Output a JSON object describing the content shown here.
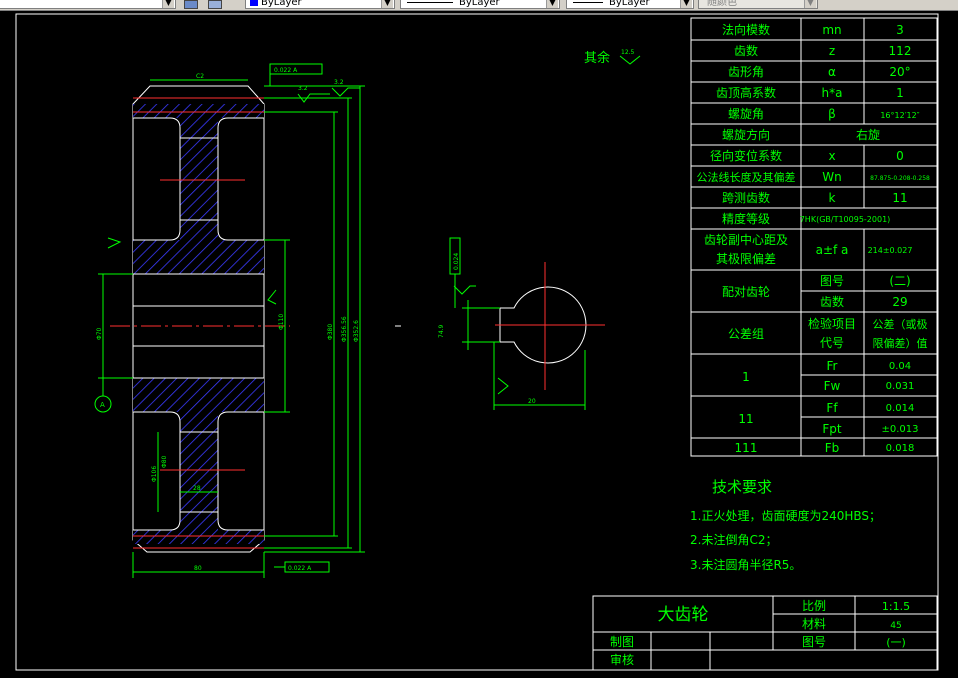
{
  "toolbar": {
    "color_combo": "ByLayer",
    "linetype_combo": "ByLayer",
    "lineweight_combo": "ByLayer",
    "plotstyle_combo": "随颜色"
  },
  "drawing": {
    "roughness_note_label": "其余",
    "roughness_note_value": "12.5",
    "spec_table": [
      {
        "name": "法向模数",
        "symbol": "mn",
        "value": "3"
      },
      {
        "name": "齿数",
        "symbol": "z",
        "value": "112"
      },
      {
        "name": "齿形角",
        "symbol": "α",
        "value": "20°"
      },
      {
        "name": "齿顶高系数",
        "symbol": "h*a",
        "value": "1"
      },
      {
        "name": "螺旋角",
        "symbol": "β",
        "value": "16°12′12″"
      },
      {
        "name": "螺旋方向",
        "symbol": "",
        "value": "右旋"
      },
      {
        "name": "径向变位系数",
        "symbol": "x",
        "value": "0"
      },
      {
        "name": "公法线长度及其偏差",
        "symbol": "Wn",
        "value": "87.875-0.208-0.258"
      },
      {
        "name": "跨测齿数",
        "symbol": "k",
        "value": "11"
      },
      {
        "name": "精度等级",
        "symbol": "",
        "value": "7HK(GB/T10095-2001)"
      }
    ],
    "center_distance_label_line1": "齿轮副中心距及",
    "center_distance_label_line2": "其极限偏差",
    "center_distance_symbol": "a±f a",
    "center_distance_value": "214±0.027",
    "mating_gear_label": "配对齿轮",
    "mating_drawing_no_label": "图号",
    "mating_drawing_no_value": "(二)",
    "mating_teeth_label": "齿数",
    "mating_teeth_value": "29",
    "tolerance_header_group": "公差组",
    "tolerance_header_item_line1": "检验项目",
    "tolerance_header_item_line2": "代号",
    "tolerance_header_value_line1": "公差（或极",
    "tolerance_header_value_line2": "限偏差）值",
    "tolerance_rows": [
      {
        "group": "1",
        "code": "Fr",
        "value": "0.04"
      },
      {
        "group": "",
        "code": "Fw",
        "value": "0.031"
      },
      {
        "group": "11",
        "code": "Ff",
        "value": "0.014"
      },
      {
        "group": "",
        "code": "Fpt",
        "value": "±0.013"
      },
      {
        "group": "111",
        "code": "Fb",
        "value": "0.018"
      }
    ],
    "tech_title": "技术要求",
    "tech_items": [
      "1.正火处理，齿面硬度为240HBS；",
      "2.未注倒角C2；",
      "3.未注圆角半径R5。"
    ],
    "title_block": {
      "part_name": "大齿轮",
      "scale_label": "比例",
      "scale_value": "1:1.5",
      "material_label": "材料",
      "material_value": "45",
      "drawing_no_label": "图号",
      "drawing_no_value": "(一)",
      "drawn_label": "制图",
      "checked_label": "审核"
    },
    "dim_labels": {
      "chamfer": "C2",
      "roughness_a": "3.2",
      "roughness_b": "3.2",
      "runout_top": "0.022 A",
      "runout_bottom": "0.022 A",
      "datum": "A",
      "width": "80",
      "hub_width": "28",
      "bore": "Φ70",
      "key_depth": "74.9",
      "keyway_width": "20",
      "sym_tol": "0.024",
      "d1": "Φ110",
      "d2": "Φ380",
      "d3": "Φ356.56",
      "d4": "Φ352.6",
      "d5": "Φ106",
      "hole": "Φ80"
    }
  }
}
